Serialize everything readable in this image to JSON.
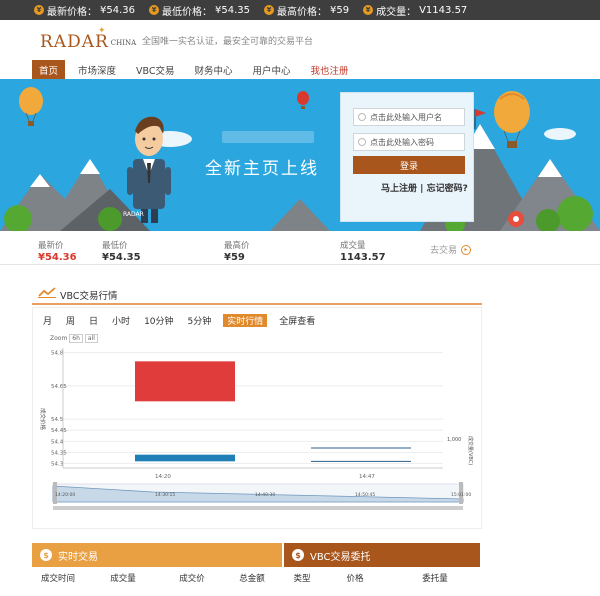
{
  "ticker": {
    "items": [
      {
        "icon": "price-icon",
        "label": "最新价格：",
        "value": "¥54.36"
      },
      {
        "icon": "price-icon",
        "label": "最低价格：",
        "value": "¥54.35"
      },
      {
        "icon": "price-icon",
        "label": "最高价格：",
        "value": "¥59"
      },
      {
        "icon": "price-icon",
        "label": "成交量：",
        "value": "V1143.57"
      }
    ]
  },
  "header": {
    "logo_text": "RADAR",
    "logo_sub": "CHINA",
    "slogan": "全国唯一实名认证，最安全可靠的交易平台"
  },
  "nav": {
    "items": [
      "首页",
      "市场深度",
      "VBC交易",
      "财务中心",
      "用户中心",
      "我也注册"
    ]
  },
  "banner": {
    "title": "全新主页上线",
    "person_label": "RADAR"
  },
  "login": {
    "username_placeholder": "点击此处输入用户名",
    "password_placeholder": "点击此处输入密码",
    "login_button": "登录",
    "register_link": "马上注册",
    "separator": "|",
    "forgot_link": "忘记密码?"
  },
  "prices": {
    "latest_label": "最新价",
    "latest_value": "¥54.36",
    "low_label": "最低价",
    "low_value": "¥54.35",
    "high_label": "最高价",
    "high_value": "¥59",
    "volume_label": "成交量",
    "volume_value": "1143.57",
    "more_label": "去交易"
  },
  "chart_panel": {
    "title": "VBC交易行情",
    "tabs": [
      "月",
      "周",
      "日",
      "小时",
      "10分钟",
      "5分钟",
      "实时行情",
      "全屏查看"
    ],
    "active_tab": "实时行情",
    "zoom_label": "Zoom",
    "zoom_options": [
      "6h",
      "all"
    ]
  },
  "chart_data": {
    "type": "candlestick",
    "y_ticks": [
      54.8,
      54.65,
      54.5,
      54.45,
      54.4,
      54.35,
      54.3
    ],
    "ylim": [
      54.28,
      54.82
    ],
    "ylabel": "成交价格",
    "y2label": "成交量(VBC)",
    "y2_tick": "1,000",
    "x_ticks": [
      "14:20",
      "14:47"
    ],
    "nav_ticks": [
      "14:20:00",
      "14:30:15",
      "14:40:30",
      "14:50:45",
      "15:01:00"
    ],
    "candles": [
      {
        "x": 0.15,
        "open": 54.76,
        "close": 54.58,
        "color": "#e03c3c"
      },
      {
        "x": 0.15,
        "open": 54.34,
        "close": 54.31,
        "color": "#1f80b8"
      }
    ],
    "volume_levels": [
      54.37,
      54.31
    ],
    "grid": true
  },
  "realtime": {
    "title": "实时交易",
    "columns": [
      "成交时间",
      "成交量",
      "成交价",
      "总金额"
    ]
  },
  "vbc_orders": {
    "title": "VBC交易委托",
    "columns": [
      "类型",
      "价格",
      "委托量"
    ]
  },
  "colors": {
    "brand": "#a8561c",
    "accent": "#e9a042",
    "banner_bg": "#2ba6de",
    "up": "#e03c3c",
    "down": "#1f80b8"
  }
}
